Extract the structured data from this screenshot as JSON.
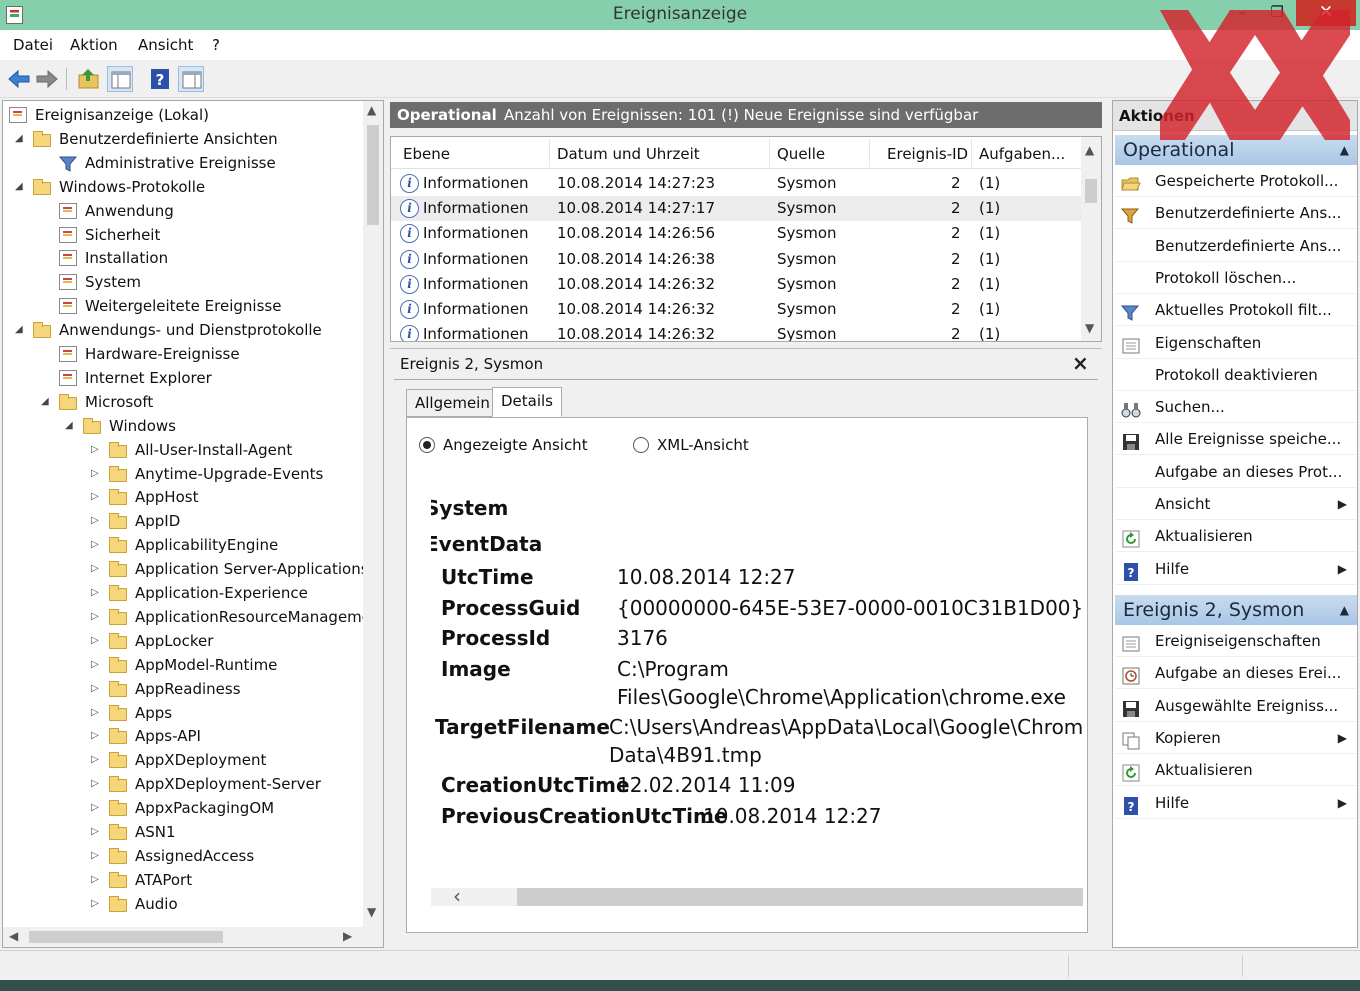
{
  "window": {
    "title": "Ereignisanzeige",
    "minimize": "–",
    "maximize": "❐",
    "close": "✕"
  },
  "menu": [
    "Datei",
    "Aktion",
    "Ansicht",
    "?"
  ],
  "toolbar": {
    "icons": [
      "back-arrow-icon",
      "forward-arrow-icon",
      "folder-up-icon",
      "console-tree-icon",
      "help-icon",
      "action-pane-icon"
    ]
  },
  "tree": {
    "items": [
      {
        "label": "Ereignisanzeige (Lokal)",
        "level": 0,
        "arrow": "",
        "icon": "computer"
      },
      {
        "label": "Benutzerdefinierte Ansichten",
        "level": 1,
        "arrow": "◢",
        "icon": "folder"
      },
      {
        "label": "Administrative Ereignisse",
        "level": 2,
        "arrow": "",
        "icon": "filter"
      },
      {
        "label": "Windows-Protokolle",
        "level": 1,
        "arrow": "◢",
        "icon": "folder"
      },
      {
        "label": "Anwendung",
        "level": 2,
        "arrow": "",
        "icon": "log"
      },
      {
        "label": "Sicherheit",
        "level": 2,
        "arrow": "",
        "icon": "log"
      },
      {
        "label": "Installation",
        "level": 2,
        "arrow": "",
        "icon": "log"
      },
      {
        "label": "System",
        "level": 2,
        "arrow": "",
        "icon": "log"
      },
      {
        "label": "Weitergeleitete Ereignisse",
        "level": 2,
        "arrow": "",
        "icon": "log"
      },
      {
        "label": "Anwendungs- und Dienstprotokolle",
        "level": 1,
        "arrow": "◢",
        "icon": "folder"
      },
      {
        "label": "Hardware-Ereignisse",
        "level": 2,
        "arrow": "",
        "icon": "log"
      },
      {
        "label": "Internet Explorer",
        "level": 2,
        "arrow": "",
        "icon": "log"
      },
      {
        "label": "Microsoft",
        "level": 2,
        "arrow": "◢",
        "icon": "folder"
      },
      {
        "label": "Windows",
        "level": 3,
        "arrow": "◢",
        "icon": "folder"
      },
      {
        "label": "All-User-Install-Agent",
        "level": 4,
        "arrow": "▷",
        "icon": "folder"
      },
      {
        "label": "Anytime-Upgrade-Events",
        "level": 4,
        "arrow": "▷",
        "icon": "folder"
      },
      {
        "label": "AppHost",
        "level": 4,
        "arrow": "▷",
        "icon": "folder"
      },
      {
        "label": "AppID",
        "level": 4,
        "arrow": "▷",
        "icon": "folder"
      },
      {
        "label": "ApplicabilityEngine",
        "level": 4,
        "arrow": "▷",
        "icon": "folder"
      },
      {
        "label": "Application Server-Applications",
        "level": 4,
        "arrow": "▷",
        "icon": "folder"
      },
      {
        "label": "Application-Experience",
        "level": 4,
        "arrow": "▷",
        "icon": "folder"
      },
      {
        "label": "ApplicationResourceManageme",
        "level": 4,
        "arrow": "▷",
        "icon": "folder"
      },
      {
        "label": "AppLocker",
        "level": 4,
        "arrow": "▷",
        "icon": "folder"
      },
      {
        "label": "AppModel-Runtime",
        "level": 4,
        "arrow": "▷",
        "icon": "folder"
      },
      {
        "label": "AppReadiness",
        "level": 4,
        "arrow": "▷",
        "icon": "folder"
      },
      {
        "label": "Apps",
        "level": 4,
        "arrow": "▷",
        "icon": "folder"
      },
      {
        "label": "Apps-API",
        "level": 4,
        "arrow": "▷",
        "icon": "folder"
      },
      {
        "label": "AppXDeployment",
        "level": 4,
        "arrow": "▷",
        "icon": "folder"
      },
      {
        "label": "AppXDeployment-Server",
        "level": 4,
        "arrow": "▷",
        "icon": "folder"
      },
      {
        "label": "AppxPackagingOM",
        "level": 4,
        "arrow": "▷",
        "icon": "folder"
      },
      {
        "label": "ASN1",
        "level": 4,
        "arrow": "▷",
        "icon": "folder"
      },
      {
        "label": "AssignedAccess",
        "level": 4,
        "arrow": "▷",
        "icon": "folder"
      },
      {
        "label": "ATAPort",
        "level": 4,
        "arrow": "▷",
        "icon": "folder"
      },
      {
        "label": "Audio",
        "level": 4,
        "arrow": "▷",
        "icon": "folder"
      }
    ]
  },
  "log_header": {
    "name": "Operational",
    "status": "Anzahl von Ereignissen: 101 (!) Neue Ereignisse sind verfügbar"
  },
  "grid": {
    "columns": [
      "Ebene",
      "Datum und Uhrzeit",
      "Quelle",
      "Ereignis-ID",
      "Aufgaben..."
    ],
    "rows": [
      {
        "level": "Informationen",
        "datetime": "10.08.2014 14:27:23",
        "source": "Sysmon",
        "id": "2",
        "task": "(1)",
        "selected": false
      },
      {
        "level": "Informationen",
        "datetime": "10.08.2014 14:27:17",
        "source": "Sysmon",
        "id": "2",
        "task": "(1)",
        "selected": true
      },
      {
        "level": "Informationen",
        "datetime": "10.08.2014 14:26:56",
        "source": "Sysmon",
        "id": "2",
        "task": "(1)",
        "selected": false
      },
      {
        "level": "Informationen",
        "datetime": "10.08.2014 14:26:38",
        "source": "Sysmon",
        "id": "2",
        "task": "(1)",
        "selected": false
      },
      {
        "level": "Informationen",
        "datetime": "10.08.2014 14:26:32",
        "source": "Sysmon",
        "id": "2",
        "task": "(1)",
        "selected": false
      },
      {
        "level": "Informationen",
        "datetime": "10.08.2014 14:26:32",
        "source": "Sysmon",
        "id": "2",
        "task": "(1)",
        "selected": false
      },
      {
        "level": "Informationen",
        "datetime": "10.08.2014 14:26:32",
        "source": "Sysmon",
        "id": "2",
        "task": "(1)",
        "selected": false
      }
    ]
  },
  "event_panel": {
    "title": "Ereignis 2, Sysmon",
    "close": "×",
    "tabs": [
      "Allgemein",
      "Details"
    ],
    "radio_friendly": "Angezeigte Ansicht",
    "radio_xml": "XML-Ansicht",
    "section_system": "System",
    "section_eventdata": "EventData",
    "fields": {
      "utctime_key": "UtcTime",
      "utctime_val": "10.08.2014 12:27",
      "processguid_key": "ProcessGuid",
      "processguid_val": "{00000000-645E-53E7-0000-0010C31B1D00}",
      "processid_key": "ProcessId",
      "processid_val": "3176",
      "image_key": "Image",
      "image_val1": "C:\\Program",
      "image_val2": "Files\\Google\\Chrome\\Application\\chrome.exe",
      "target_key": "TargetFilename",
      "target_val1": "C:\\Users\\Andreas\\AppData\\Local\\Google\\Chrome\\U",
      "target_val2": "Data\\4B91.tmp",
      "creation_key": "CreationUtcTime",
      "creation_val": "12.02.2014 11:09",
      "prevcreation_key": "PreviousCreationUtcTime",
      "prevcreation_val": "10.08.2014 12:27"
    }
  },
  "actions": {
    "title": "Aktionen",
    "section1": "Operational",
    "items1": [
      {
        "label": "Gespeicherte Protokoll...",
        "icon": "folder-open-icon",
        "submenu": false
      },
      {
        "label": "Benutzerdefinierte Ans...",
        "icon": "filter-create-icon",
        "submenu": false
      },
      {
        "label": "Benutzerdefinierte Ans...",
        "icon": "",
        "submenu": false
      },
      {
        "label": "Protokoll löschen...",
        "icon": "",
        "submenu": false
      },
      {
        "label": "Aktuelles Protokoll filt...",
        "icon": "filter-icon",
        "submenu": false
      },
      {
        "label": "Eigenschaften",
        "icon": "properties-icon",
        "submenu": false
      },
      {
        "label": "Protokoll deaktivieren",
        "icon": "",
        "submenu": false
      },
      {
        "label": "Suchen...",
        "icon": "binoculars-icon",
        "submenu": false
      },
      {
        "label": "Alle Ereignisse speiche...",
        "icon": "save-icon",
        "submenu": false
      },
      {
        "label": "Aufgabe an dieses Prot...",
        "icon": "",
        "submenu": false
      },
      {
        "label": "Ansicht",
        "icon": "",
        "submenu": true
      },
      {
        "label": "Aktualisieren",
        "icon": "refresh-icon",
        "submenu": false
      },
      {
        "label": "Hilfe",
        "icon": "help-icon",
        "submenu": true
      }
    ],
    "section2": "Ereignis 2, Sysmon",
    "items2": [
      {
        "label": "Ereigniseigenschaften",
        "icon": "properties-icon",
        "submenu": false
      },
      {
        "label": "Aufgabe an dieses Erei...",
        "icon": "task-icon",
        "submenu": false
      },
      {
        "label": "Ausgewählte Ereigniss...",
        "icon": "save-icon",
        "submenu": false
      },
      {
        "label": "Kopieren",
        "icon": "copy-icon",
        "submenu": true
      },
      {
        "label": "Aktualisieren",
        "icon": "refresh-icon",
        "submenu": false
      },
      {
        "label": "Hilfe",
        "icon": "help-icon",
        "submenu": true
      }
    ]
  },
  "colors": {
    "titlebar": "#86cfad",
    "close_button": "#c7392f",
    "section_header": "#b5cfea",
    "watermark": "#d4232b"
  }
}
